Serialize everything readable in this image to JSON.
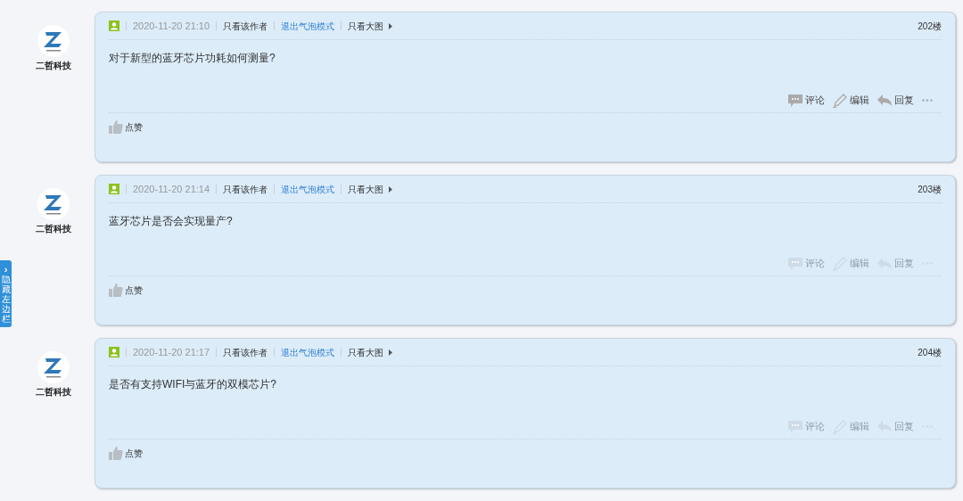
{
  "side_tab": {
    "icon_char": "›",
    "label": "隐藏左边栏"
  },
  "posts": [
    {
      "author": "二哲科技",
      "time": "2020-11-20 21:10",
      "links": [
        {
          "label": "只看该作者",
          "kind": "plain"
        },
        {
          "label": "退出气泡模式",
          "kind": "link"
        },
        {
          "label": "只看大图",
          "kind": "menu"
        }
      ],
      "floor": "202楼",
      "content": "对于新型的蓝牙芯片功耗如何测量?",
      "actions": [
        "评论",
        "编辑",
        "回复"
      ],
      "actions_active": true,
      "like": "点赞"
    },
    {
      "author": "二哲科技",
      "time": "2020-11-20 21:14",
      "links": [
        {
          "label": "只看该作者",
          "kind": "plain"
        },
        {
          "label": "退出气泡模式",
          "kind": "link"
        },
        {
          "label": "只看大图",
          "kind": "menu"
        }
      ],
      "floor": "203楼",
      "content": "蓝牙芯片是否会实现量产?",
      "actions": [
        "评论",
        "编辑",
        "回复"
      ],
      "actions_active": false,
      "like": "点赞"
    },
    {
      "author": "二哲科技",
      "time": "2020-11-20 21:17",
      "links": [
        {
          "label": "只看该作者",
          "kind": "plain"
        },
        {
          "label": "退出气泡模式",
          "kind": "link"
        },
        {
          "label": "只看大图",
          "kind": "menu"
        }
      ],
      "floor": "204楼",
      "content": "是否有支持WIFI与蓝牙的双模芯片?",
      "actions": [
        "评论",
        "编辑",
        "回复"
      ],
      "actions_active": false,
      "like": "点赞"
    }
  ]
}
